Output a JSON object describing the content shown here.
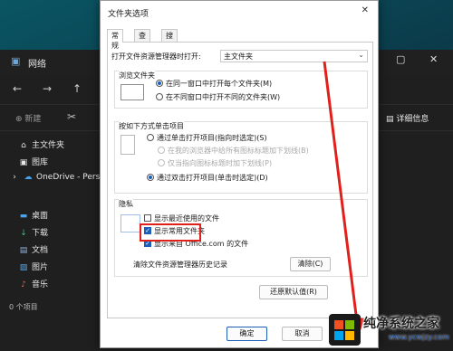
{
  "explorer": {
    "title": "网络",
    "toolbar": {
      "new_label": "新建",
      "details_label": "详细信息"
    },
    "sidebar": [
      {
        "label": "主文件夹",
        "icon": "home-icon"
      },
      {
        "label": "图库",
        "icon": "gallery-icon"
      },
      {
        "label": "OneDrive - Personal",
        "icon": "cloud-icon"
      },
      {
        "label": "桌面",
        "icon": "desktop-icon"
      },
      {
        "label": "下载",
        "icon": "download-icon"
      },
      {
        "label": "文档",
        "icon": "document-icon"
      },
      {
        "label": "图片",
        "icon": "pictures-icon"
      },
      {
        "label": "音乐",
        "icon": "music-icon"
      }
    ],
    "status": "0 个项目"
  },
  "dialog": {
    "title": "文件夹选项",
    "tabs": [
      "常规",
      "查看",
      "搜索"
    ],
    "open_label": "打开文件资源管理器时打开:",
    "open_value": "主文件夹",
    "browse": {
      "title": "浏览文件夹",
      "opt1": "在同一窗口中打开每个文件夹(M)",
      "opt2": "在不同窗口中打开不同的文件夹(W)"
    },
    "click": {
      "title": "按如下方式单击项目",
      "opt1": "通过单击打开项目(指向时选定)(S)",
      "sub1": "在我的浏览器中给所有图标标题加下划线(B)",
      "sub2": "仅当指向图标标题时加下划线(P)",
      "opt2": "通过双击打开项目(单击时选定)(D)"
    },
    "privacy": {
      "title": "隐私",
      "chk1": "显示最近使用的文件",
      "chk2": "显示常用文件夹",
      "chk3": "显示来自 Office.com 的文件",
      "clear_label": "清除文件资源管理器历史记录",
      "clear_button": "清除(C)"
    },
    "restore_button": "还原默认值(R)",
    "ok_button": "确定",
    "cancel_button": "取消"
  },
  "logo": {
    "main": "纯净系统之家",
    "sub": "www.ycwjzy.com"
  },
  "colors": {
    "accent": "#1d5fb8",
    "highlight": "#e0201a"
  }
}
